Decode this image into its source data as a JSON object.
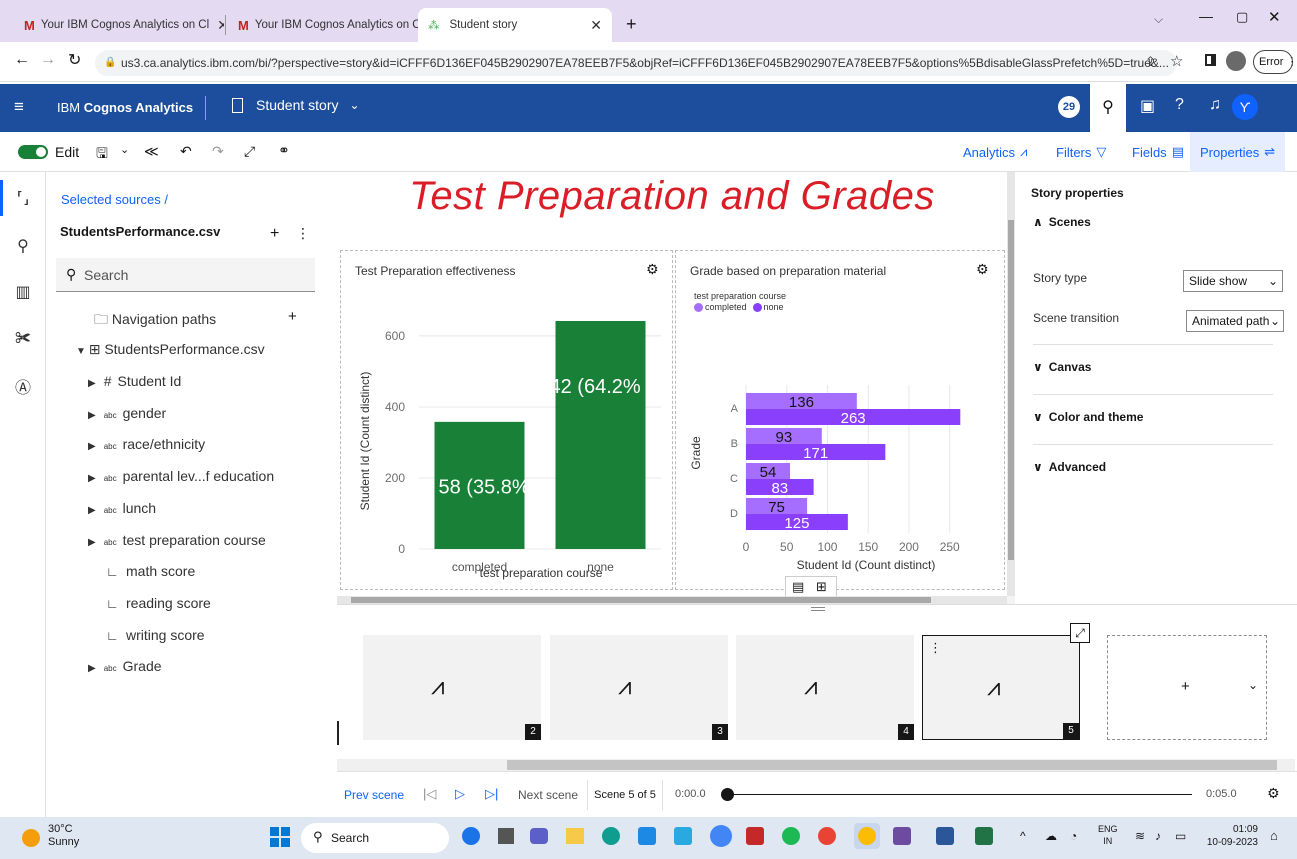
{
  "browser": {
    "tabs": [
      {
        "title": "Your IBM Cognos Analytics on Cl"
      },
      {
        "title": "Your IBM Cognos Analytics on Cl"
      },
      {
        "title": "Student story"
      }
    ],
    "url": "us3.ca.analytics.ibm.com/bi/?perspective=story&id=iCFFF6D136EF045B2902907EA78EEB7F5&objRef=iCFFF6D136EF045B2902907EA78EEB7F5&options%5BdisableGlassPrefetch%5D=true&...",
    "error_label": "Error"
  },
  "app": {
    "brand_prefix": "IBM ",
    "brand_name": "Cognos Analytics",
    "story_title": "Student story",
    "notification_count": "29"
  },
  "toolbar": {
    "edit_label": "Edit",
    "analytics": "Analytics",
    "filters": "Filters",
    "fields": "Fields",
    "properties": "Properties"
  },
  "sources": {
    "breadcrumb": "Selected sources  /",
    "file": "StudentsPerformance.csv",
    "search_placeholder": "Search",
    "nav_paths": "Navigation paths",
    "dataset": "StudentsPerformance.csv",
    "fields": [
      {
        "label": "Student Id",
        "type": "#"
      },
      {
        "label": "gender",
        "type": "abc"
      },
      {
        "label": "race/ethnicity",
        "type": "abc"
      },
      {
        "label": "parental lev...f education",
        "type": "abc"
      },
      {
        "label": "lunch",
        "type": "abc"
      },
      {
        "label": "test preparation course",
        "type": "abc"
      },
      {
        "label": "math score",
        "type": "measure"
      },
      {
        "label": "reading score",
        "type": "measure"
      },
      {
        "label": "writing score",
        "type": "measure"
      },
      {
        "label": "Grade",
        "type": "abc"
      }
    ]
  },
  "story": {
    "heading": "Test Preparation and Grades"
  },
  "chart_data": [
    {
      "type": "bar",
      "title": "Test Preparation effectiveness",
      "xlabel": "test preparation course",
      "ylabel": "Student Id (Count distinct)",
      "categories": [
        "completed",
        "none"
      ],
      "values": [
        358,
        642
      ],
      "data_labels": [
        "58 (35.8%",
        "42 (64.2%"
      ],
      "ylim": [
        0,
        642
      ],
      "yticks": [
        "0",
        "200",
        "400",
        "600"
      ],
      "color": "#198038"
    },
    {
      "type": "bar",
      "orientation": "horizontal",
      "title": "Grade based on preparation material",
      "legend_title": "test preparation course",
      "xlabel": "Student Id (Count distinct)",
      "ylabel": "Grade",
      "categories": [
        "A",
        "B",
        "C",
        "D"
      ],
      "series": [
        {
          "name": "completed",
          "values": [
            136,
            93,
            54,
            75
          ],
          "color": "#a56eff"
        },
        {
          "name": "none",
          "values": [
            263,
            171,
            83,
            125
          ],
          "color": "#8a3ffc"
        }
      ],
      "xlim": [
        0,
        270
      ],
      "xticks": [
        "0",
        "50",
        "100",
        "150",
        "200",
        "250"
      ]
    }
  ],
  "properties": {
    "title": "Story properties",
    "scenes": "Scenes",
    "story_type_label": "Story type",
    "story_type_value": "Slide show",
    "transition_label": "Scene transition",
    "transition_value": "Animated path",
    "canvas": "Canvas",
    "color_theme": "Color and theme",
    "advanced": "Advanced"
  },
  "scenes": {
    "numbers": [
      "2",
      "3",
      "4",
      "5"
    ],
    "prev": "Prev scene",
    "next": "Next scene",
    "counter": "Scene 5 of 5",
    "time_start": "0:00.0",
    "time_end": "0:05.0"
  },
  "taskbar": {
    "temp": "30°C",
    "weather": "Sunny",
    "search": "Search",
    "lang1": "ENG",
    "lang2": "IN",
    "time": "01:09",
    "date": "10-09-2023"
  }
}
